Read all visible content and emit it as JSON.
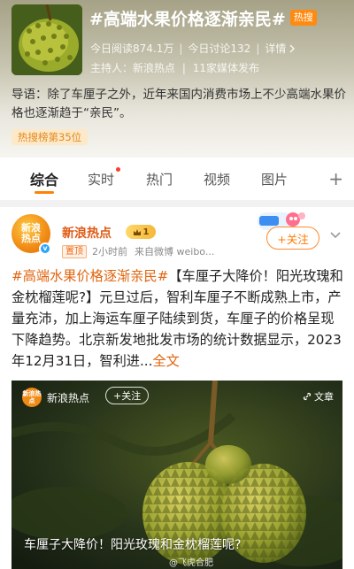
{
  "topic": {
    "title": "#高端水果价格逐渐亲民#",
    "hot_badge": "热搜",
    "reads": "今日阅读874.1万",
    "discussions": "今日讨论132",
    "details": "详情",
    "host_label": "主持人：",
    "host_name": "新浪热点",
    "media_count": "11家媒体发布",
    "intro": "导语：除了车厘子之外，近年来国内消费市场上不少高端水果价格也逐渐趋于“亲民”。",
    "rank": "热搜榜第35位"
  },
  "tabs": [
    {
      "label": "综合",
      "active": true
    },
    {
      "label": "实时",
      "has_dot": true
    },
    {
      "label": "热门"
    },
    {
      "label": "视频"
    },
    {
      "label": "图片"
    }
  ],
  "tabs_more": "+",
  "post": {
    "author": "新浪热点",
    "avatar_text": "新浪热点",
    "level": "1",
    "pin": "置顶",
    "time": "2小时前",
    "source": "来自微博 weibo...",
    "follow": "+关注",
    "hashtag": "#高端水果价格逐渐亲民#",
    "body": "【车厘子大降价！阳光玫瑰和金枕榴莲呢?】元旦过后，智利车厘子不断成熟上市，产量充沛，加上海运车厘子陆续到货，车厘子的价格呈现下降趋势。北京新发地批发市场的统计数据显示，2023年12月31日，智利进...",
    "full_text": "全文"
  },
  "video": {
    "channel": "新浪热点",
    "logo_text": "新浪热点",
    "follow": "+关注",
    "article": "文章",
    "caption": "车厘子大降价！阳光玫瑰和金枕榴莲呢?",
    "watermark": "@飞虎合肥"
  },
  "colors": {
    "accent": "#ff8200",
    "link": "#e0650f",
    "hot_badge": "#ff8a10"
  }
}
